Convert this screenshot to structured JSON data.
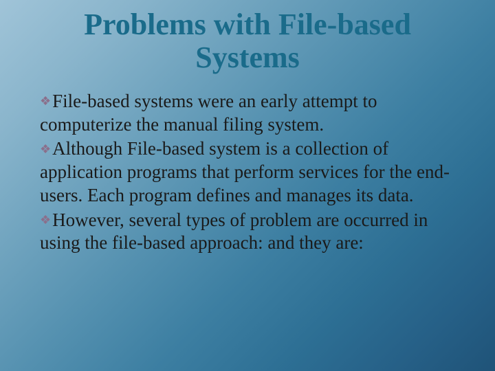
{
  "slide": {
    "title": "Problems with File-based Systems",
    "bullets": [
      "File-based systems were an early attempt to computerize the manual filing system.",
      "Although File-based system is a collection of application programs that perform services for the end-users.  Each program defines and manages its data.",
      "However, several types of problem are occurred in using the file-based approach: and they are:"
    ]
  }
}
